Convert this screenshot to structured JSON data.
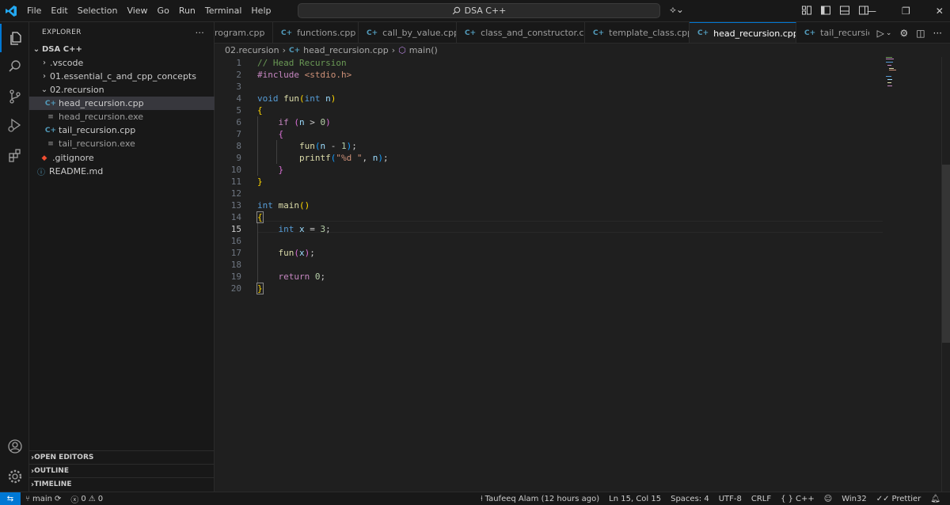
{
  "titlebar": {
    "menu": [
      "File",
      "Edit",
      "Selection",
      "View",
      "Go",
      "Run",
      "Terminal",
      "Help"
    ],
    "search": "DSA C++"
  },
  "sidebar": {
    "header": "EXPLORER",
    "more": "···",
    "root": "DSA C++",
    "items": [
      {
        "label": ".vscode",
        "kind": "folder-closed"
      },
      {
        "label": "01.essential_c_and_cpp_concepts",
        "kind": "folder-closed"
      },
      {
        "label": "02.recursion",
        "kind": "folder-open"
      },
      {
        "label": "head_recursion.cpp",
        "kind": "cpp"
      },
      {
        "label": "head_recursion.exe",
        "kind": "exe"
      },
      {
        "label": "tail_recursion.cpp",
        "kind": "cpp"
      },
      {
        "label": "tail_recursion.exe",
        "kind": "exe"
      },
      {
        "label": ".gitignore",
        "kind": "git"
      },
      {
        "label": "README.md",
        "kind": "info"
      }
    ],
    "sections": [
      "OPEN EDITORS",
      "OUTLINE",
      "TIMELINE"
    ]
  },
  "tabs": [
    {
      "label": "rogram.cpp"
    },
    {
      "label": "functions.cpp"
    },
    {
      "label": "call_by_value.cpp"
    },
    {
      "label": "class_and_constructor.cpp"
    },
    {
      "label": "template_class.cpp"
    },
    {
      "label": "head_recursion.cpp"
    },
    {
      "label": "tail_recursion.cp"
    }
  ],
  "tab_icon": "C+",
  "breadcrumb": {
    "folder": "02.recursion",
    "file": "head_recursion.cpp",
    "symbol": "main()"
  },
  "editor": {
    "current_line": 15,
    "line_numbers": [
      "1",
      "2",
      "3",
      "4",
      "5",
      "6",
      "7",
      "8",
      "9",
      "10",
      "11",
      "12",
      "13",
      "14",
      "15",
      "16",
      "17",
      "18",
      "19",
      "20"
    ]
  },
  "statusbar": {
    "branch": "main",
    "errors": "0",
    "warnings": "0",
    "blame": "Taufeeq Alam (12 hours ago)",
    "position": "Ln 15, Col 15",
    "spaces": "Spaces: 4",
    "encoding": "UTF-8",
    "eol": "CRLF",
    "language": "C++",
    "platform": "Win32",
    "formatter": "Prettier"
  },
  "colors": {
    "accent": "#0078d4",
    "background": "#1f1f1f",
    "panel": "#181818"
  }
}
